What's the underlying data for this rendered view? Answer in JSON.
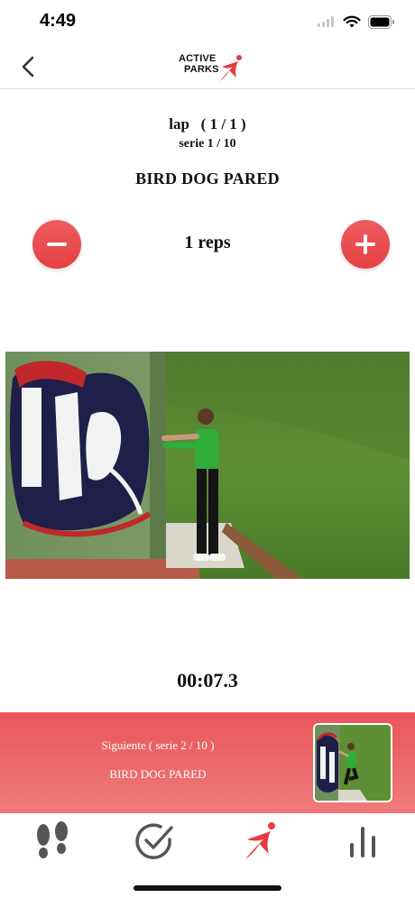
{
  "status": {
    "time": "4:49"
  },
  "header": {
    "logo_line1": "ACTIVE",
    "logo_line2": "PARKS"
  },
  "workout": {
    "lap": "lap   ( 1 / 1 )",
    "serie": "serie 1 / 10",
    "exercise": "BIRD DOG PARED",
    "reps": "1 reps",
    "timer": "00:07.3"
  },
  "next": {
    "label": "Siguiente ( serie 2 / 10 )",
    "exercise": "BIRD DOG PARED"
  },
  "colors": {
    "accent": "#e8494b",
    "panel_top": "#e8575a",
    "panel_bottom": "#f07a7a"
  },
  "icons": {
    "back": "chevron-left-icon",
    "minus": "minus-icon",
    "plus": "plus-icon",
    "tabs": [
      "footprints-icon",
      "check-circle-icon",
      "active-parks-logo-icon",
      "bar-chart-icon"
    ]
  }
}
